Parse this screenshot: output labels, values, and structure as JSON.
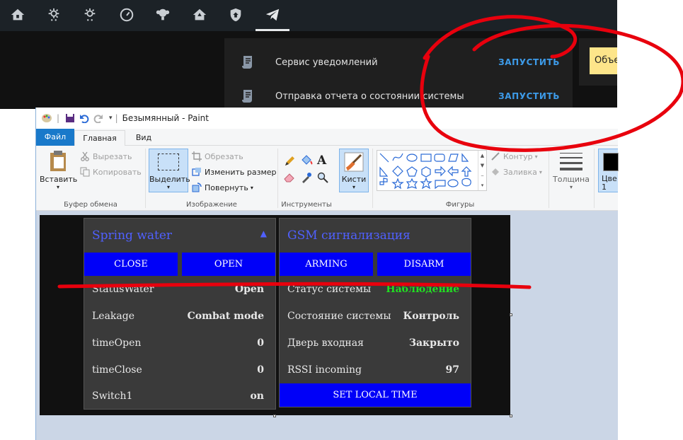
{
  "topbar": {
    "icons": [
      "home-lock-icon",
      "weather-snow-icon",
      "weather-partly-cloudy-icon",
      "gauge-icon",
      "lightbulb-group-icon",
      "home-outline-icon",
      "shield-home-icon",
      "telegram-icon"
    ]
  },
  "services": {
    "items": [
      {
        "label": "Сервис уведомлений",
        "action": "ЗАПУСТИТЬ"
      },
      {
        "label": "Отправка отчета о состоянии системы",
        "action": "ЗАПУСТИТЬ"
      }
    ],
    "chip_text": "Объе"
  },
  "paint": {
    "title": "Безымянный - Paint",
    "tabs": {
      "file": "Файл",
      "home": "Главная",
      "view": "Вид"
    },
    "ribbon": {
      "clipboard": {
        "paste": "Вставить",
        "cut": "Вырезать",
        "copy": "Копировать",
        "group": "Буфер обмена"
      },
      "image": {
        "select": "Выделить",
        "crop": "Обрезать",
        "resize": "Изменить размер",
        "rotate": "Повернуть",
        "group": "Изображение"
      },
      "tools": {
        "group": "Инструменты"
      },
      "brushes": {
        "label": "Кисти"
      },
      "shapes": {
        "outline": "Контур",
        "fill": "Заливка",
        "group": "Фигуры"
      },
      "size": {
        "label": "Толщина"
      },
      "color": {
        "label1": "Цве",
        "label2": "1"
      }
    }
  },
  "ha": {
    "spring": {
      "title": "Spring water",
      "buttons": [
        "CLOSE",
        "OPEN"
      ],
      "rows": [
        {
          "k": "StatusWater",
          "v": "Open"
        },
        {
          "k": "Leakage",
          "v": "Combat mode"
        },
        {
          "k": "timeOpen",
          "v": "0"
        },
        {
          "k": "timeClose",
          "v": "0"
        },
        {
          "k": "Switch1",
          "v": "on"
        }
      ]
    },
    "gsm": {
      "title": "GSM сигнализация",
      "buttons": [
        "ARMING",
        "DISARM"
      ],
      "rows": [
        {
          "k": "Статус системы",
          "v": "Наблюдение"
        },
        {
          "k": "Состояние системы",
          "v": "Контроль"
        },
        {
          "k": "Дверь входная",
          "v": "Закрыто"
        },
        {
          "k": "RSSI incoming",
          "v": "97"
        }
      ],
      "bottom_button": "SET LOCAL TIME"
    }
  },
  "colors": {
    "accent_blue": "#3d9be9",
    "button_blue": "#0000f8",
    "status_green": "#22dd22",
    "annotation_red": "#e8000d"
  }
}
